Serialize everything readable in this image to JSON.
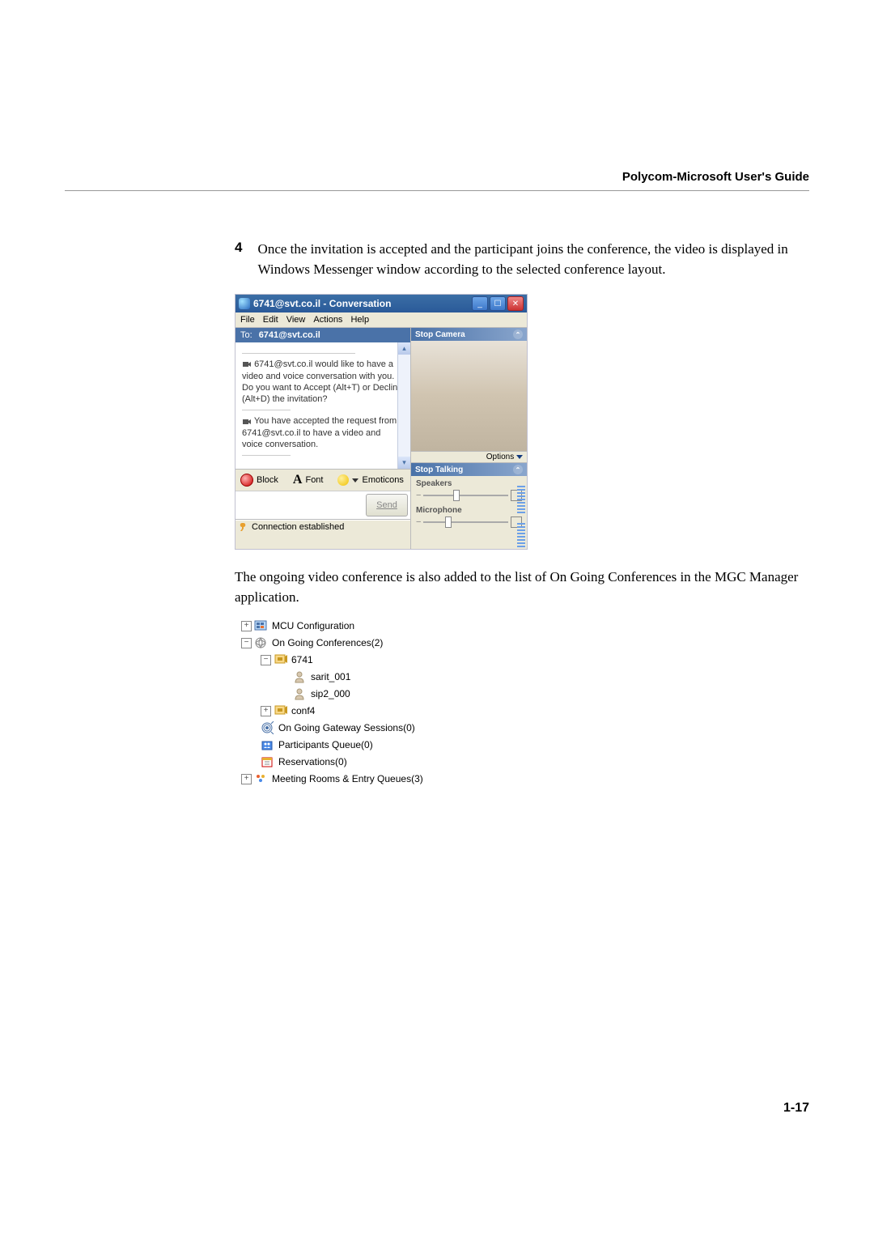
{
  "header": {
    "title": "Polycom-Microsoft User's Guide"
  },
  "step": {
    "number": "4",
    "text": "Once the invitation is accepted and the participant joins the conference, the video is displayed in Windows Messenger window according to the selected conference layout."
  },
  "messenger": {
    "title": "6741@svt.co.il - Conversation",
    "menu": [
      "File",
      "Edit",
      "View",
      "Actions",
      "Help"
    ],
    "to_label": "To:",
    "to_value": "6741@svt.co.il",
    "msg1": "6741@svt.co.il would like to have a video and voice conversation with you. Do you want to Accept (Alt+T) or Decline (Alt+D) the invitation?",
    "msg2": "You have accepted the request from 6741@svt.co.il to have a video and voice conversation.",
    "block": "Block",
    "font": "Font",
    "emoticons": "Emoticons",
    "send": "Send",
    "status": "Connection established",
    "stop_camera": "Stop Camera",
    "options": "Options",
    "stop_talking": "Stop Talking",
    "speakers": "Speakers",
    "microphone": "Microphone"
  },
  "para2": "The ongoing video conference is also added to the list of On Going Conferences in the MGC Manager application.",
  "tree": {
    "mcu": "MCU Configuration",
    "ongoing": "On Going Conferences(2)",
    "conf1": "6741",
    "p1": "sarit_001",
    "p2": "sip2_000",
    "conf2": "conf4",
    "gateway": "On Going Gateway Sessions(0)",
    "queue": "Participants Queue(0)",
    "reservations": "Reservations(0)",
    "meeting": "Meeting Rooms & Entry Queues(3)"
  },
  "footer": "1-17"
}
